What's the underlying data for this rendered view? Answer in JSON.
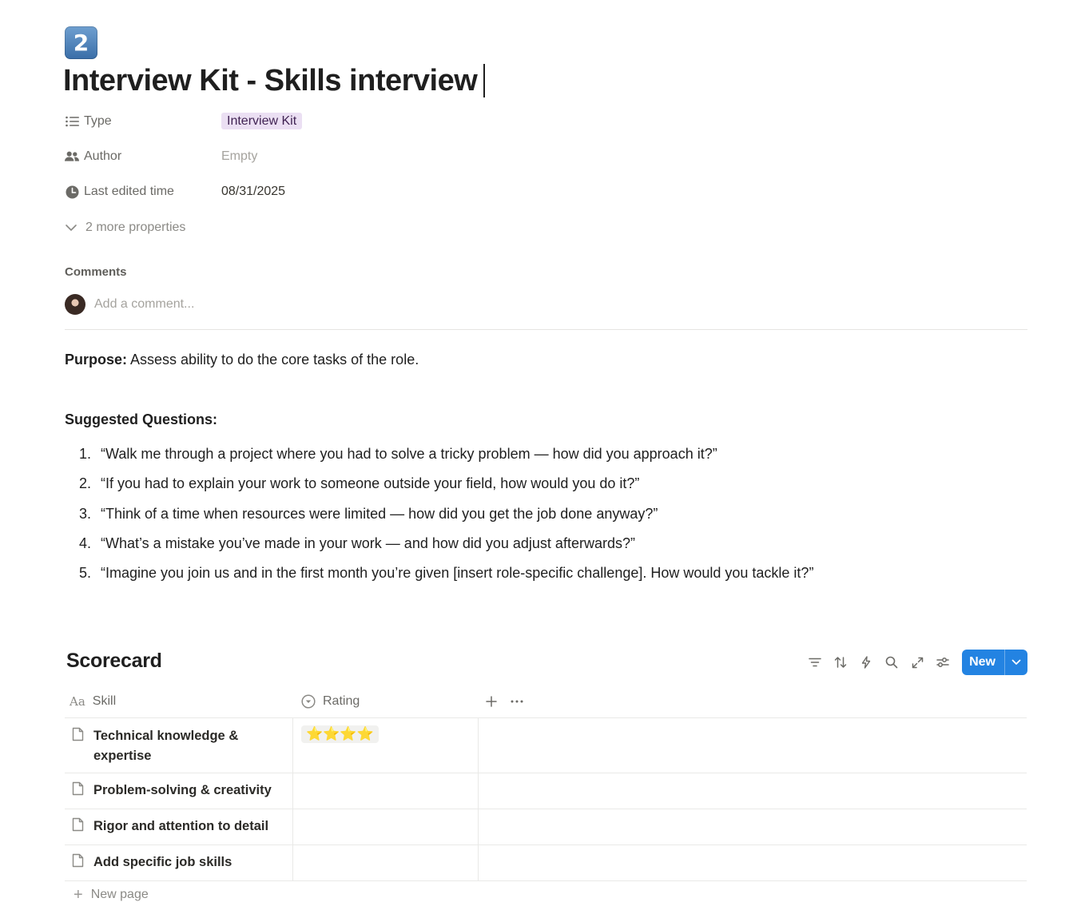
{
  "page": {
    "icon_text": "2",
    "icon_name": "keycap-2-icon",
    "title": "Interview Kit - Skills interview"
  },
  "properties": [
    {
      "label": "Type",
      "icon": "list-icon",
      "value": "Interview Kit",
      "kind": "tag"
    },
    {
      "label": "Author",
      "icon": "people-icon",
      "value": "Empty",
      "kind": "empty"
    },
    {
      "label": "Last edited time",
      "icon": "clock-icon",
      "value": "08/31/2025",
      "kind": "text"
    }
  ],
  "more_properties": "2 more properties",
  "comments": {
    "heading": "Comments",
    "placeholder": "Add a comment..."
  },
  "content": {
    "purpose_label": "Purpose:",
    "purpose_text": " Assess ability to do the core tasks of the role.",
    "questions_heading": "Suggested Questions:",
    "questions": [
      {
        "num": "1.",
        "text": "“Walk me through a project where you had to solve a tricky problem — how did you approach it?”"
      },
      {
        "num": "2.",
        "text": "“If you had to explain your work to someone outside your field, how would you do it?”"
      },
      {
        "num": "3.",
        "text": "“Think of a time when resources were limited — how did you get the job done anyway?”"
      },
      {
        "num": "4.",
        "text": "“What’s a mistake you’ve made in your work — and how did you adjust afterwards?”"
      },
      {
        "num": "5.",
        "text": "“Imagine you join us and in the first month you’re given [insert role-specific challenge]. How would you tackle it?”"
      }
    ]
  },
  "scorecard": {
    "title": "Scorecard",
    "new_button": "New",
    "columns": {
      "skill": "Skill",
      "rating": "Rating"
    },
    "rows": [
      {
        "skill": "Technical knowledge & expertise",
        "rating": "⭐⭐⭐⭐",
        "rating_value": 4
      },
      {
        "skill": "Problem-solving & creativity",
        "rating": ""
      },
      {
        "skill": "Rigor and attention to detail",
        "rating": ""
      },
      {
        "skill": "Add specific job skills",
        "rating": ""
      }
    ],
    "new_page": "New page"
  },
  "colors": {
    "accent": "#2383e2",
    "tag_bg": "#ebdff3",
    "tag_text": "#412454"
  }
}
